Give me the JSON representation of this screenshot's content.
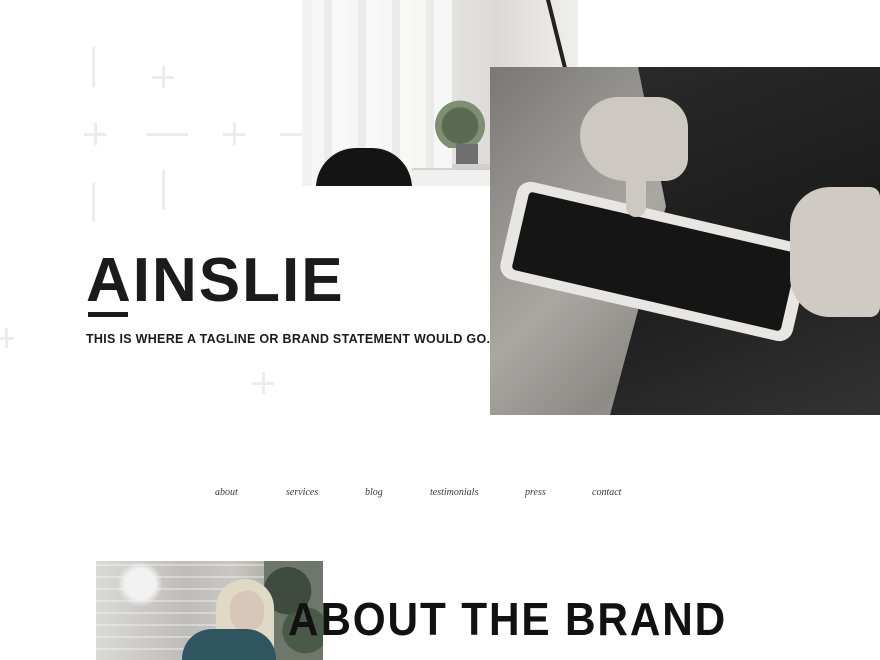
{
  "brand": {
    "name": "AINSLIE",
    "tagline": "THIS IS WHERE A TAGLINE OR BRAND STATEMENT WOULD GO."
  },
  "nav": {
    "items": [
      {
        "label": "about"
      },
      {
        "label": "services"
      },
      {
        "label": "blog"
      },
      {
        "label": "testimonials"
      },
      {
        "label": "press"
      },
      {
        "label": "contact"
      }
    ]
  },
  "about": {
    "heading": "ABOUT THE BRAND"
  },
  "colors": {
    "text": "#1b1b1b",
    "background": "#ffffff",
    "decoration": "#ececec"
  }
}
